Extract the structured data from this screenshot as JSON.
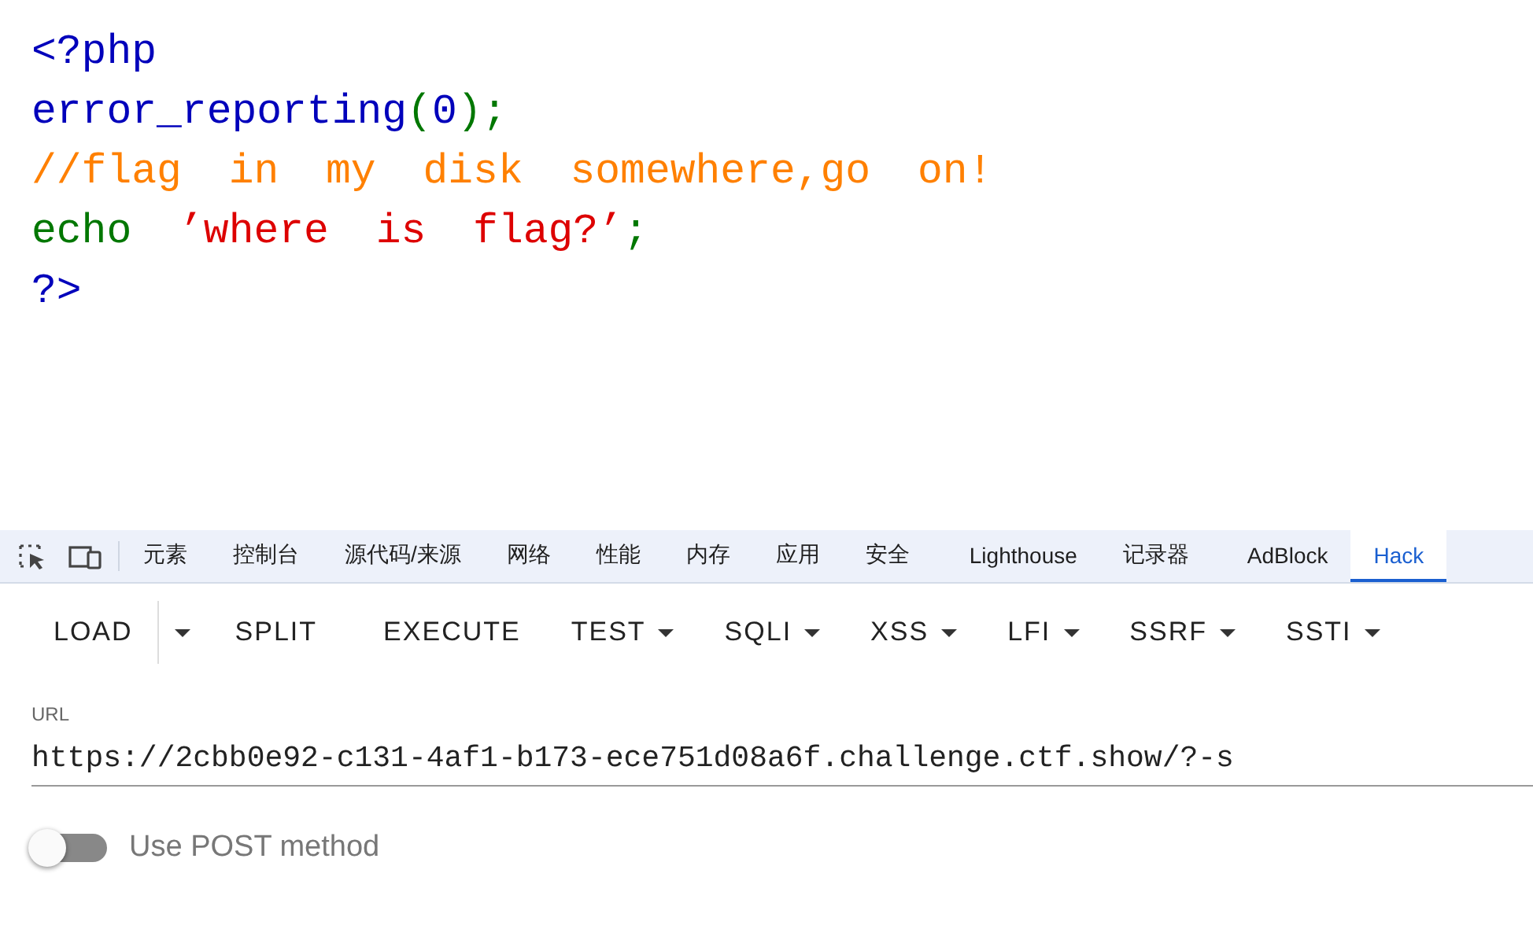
{
  "source_code": {
    "lines": [
      [
        {
          "text": "<?php",
          "kind": "default"
        }
      ],
      [
        {
          "text": "error_reporting",
          "kind": "default"
        },
        {
          "text": "(",
          "kind": "keyword"
        },
        {
          "text": "0",
          "kind": "default"
        },
        {
          "text": ");",
          "kind": "keyword"
        }
      ],
      [
        {
          "text": "//flag in my disk somewhere,go on!",
          "kind": "comment"
        }
      ],
      [
        {
          "text": "echo ",
          "kind": "keyword"
        },
        {
          "text": "’where is flag?’",
          "kind": "string"
        },
        {
          "text": ";",
          "kind": "keyword"
        }
      ],
      [
        {
          "text": "?>",
          "kind": "default"
        }
      ]
    ]
  },
  "devtools": {
    "tabs": [
      {
        "label": "元素",
        "selected": false
      },
      {
        "label": "控制台",
        "selected": false
      },
      {
        "label": "源代码/来源",
        "selected": false
      },
      {
        "label": "网络",
        "selected": false
      },
      {
        "label": "性能",
        "selected": false
      },
      {
        "label": "内存",
        "selected": false
      },
      {
        "label": "应用",
        "selected": false
      },
      {
        "label": "安全",
        "selected": false
      },
      {
        "label": "Lighthouse",
        "selected": false
      },
      {
        "label": "记录器",
        "selected": false
      },
      {
        "label": "AdBlock",
        "selected": false
      },
      {
        "label": "Hack",
        "selected": true
      }
    ]
  },
  "hackbar": {
    "toolbar": [
      {
        "label": "LOAD",
        "kind": "split"
      },
      {
        "label": "SPLIT",
        "kind": "plain"
      },
      {
        "label": "EXECUTE",
        "kind": "plain"
      },
      {
        "label": "TEST",
        "kind": "menu"
      },
      {
        "label": "SQLI",
        "kind": "menu"
      },
      {
        "label": "XSS",
        "kind": "menu"
      },
      {
        "label": "LFI",
        "kind": "menu"
      },
      {
        "label": "SSRF",
        "kind": "menu"
      },
      {
        "label": "SSTI",
        "kind": "menu"
      }
    ],
    "url_field": {
      "label": "URL",
      "value": "https://2cbb0e92-c131-4af1-b173-ece751d08a6f.challenge.ctf.show/?-s"
    },
    "post_toggle": {
      "label": "Use POST method",
      "on": false
    }
  }
}
